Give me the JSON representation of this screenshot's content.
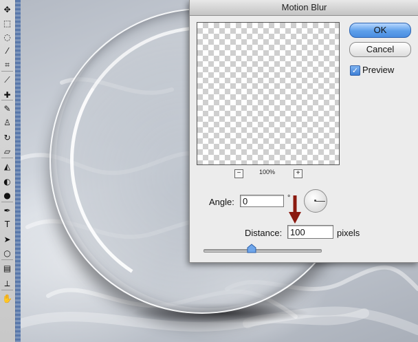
{
  "dialog": {
    "title": "Motion Blur",
    "ok_label": "OK",
    "cancel_label": "Cancel",
    "preview_label": "Preview",
    "preview_checked": true,
    "zoom_minus": "−",
    "zoom_level": "100%",
    "zoom_plus": "+",
    "angle_label": "Angle:",
    "angle_value": "0",
    "degree_symbol": "°",
    "distance_label": "Distance:",
    "distance_value": "100",
    "distance_unit": "pixels",
    "distance_slider_fraction": 0.41
  },
  "toolbar": {
    "tools": [
      {
        "icon": "move-icon",
        "glyph": "✥"
      },
      {
        "icon": "marquee-icon",
        "glyph": "⬚"
      },
      {
        "icon": "lasso-icon",
        "glyph": "◌"
      },
      {
        "icon": "magic-wand-icon",
        "glyph": "⁄"
      },
      {
        "icon": "crop-icon",
        "glyph": "⌗"
      },
      {
        "icon": "slice-icon",
        "glyph": "⟋"
      },
      {
        "icon": "healing-brush-icon",
        "glyph": "✚"
      },
      {
        "icon": "brush-icon",
        "glyph": "✎"
      },
      {
        "icon": "clone-stamp-icon",
        "glyph": "♙"
      },
      {
        "icon": "history-brush-icon",
        "glyph": "↻"
      },
      {
        "icon": "eraser-icon",
        "glyph": "▱"
      },
      {
        "icon": "paint-bucket-icon",
        "glyph": "◭"
      },
      {
        "icon": "blur-icon",
        "glyph": "◐"
      },
      {
        "icon": "dodge-icon",
        "glyph": "●"
      },
      {
        "icon": "pen-icon",
        "glyph": "✒"
      },
      {
        "icon": "type-icon",
        "glyph": "T"
      },
      {
        "icon": "path-selection-icon",
        "glyph": "➤"
      },
      {
        "icon": "shape-icon",
        "glyph": "○"
      },
      {
        "icon": "notes-icon",
        "glyph": "▤"
      },
      {
        "icon": "eyedropper-icon",
        "glyph": "⟂"
      },
      {
        "icon": "hand-icon",
        "glyph": "✋"
      }
    ]
  },
  "colors": {
    "ok_button": "#5d9fea",
    "annotation_arrow": "#8b1a10"
  }
}
